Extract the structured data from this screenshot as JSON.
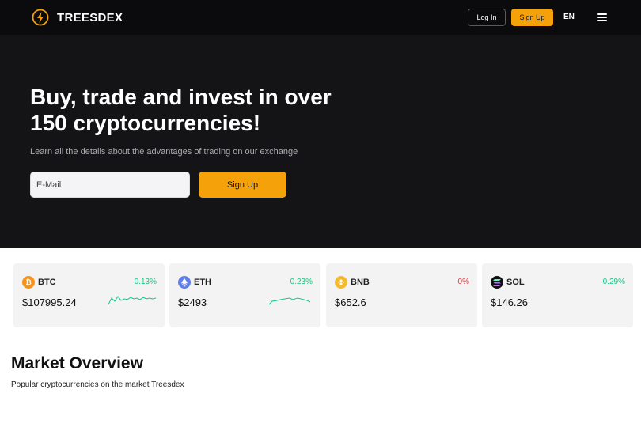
{
  "header": {
    "brand": "TREESDEX",
    "login_label": "Log In",
    "signup_label": "Sign Up",
    "language": "EN",
    "accent": "#f5a10a"
  },
  "hero": {
    "title": "Buy, trade and invest in over 150 cryptocurrencies!",
    "subtitle": "Learn all the details about the advantages of trading on our exchange",
    "email_placeholder": "E-Mail",
    "signup_label": "Sign Up"
  },
  "tickers": [
    {
      "symbol": "BTC",
      "change": "0.13%",
      "price": "$107995.24",
      "icon": "bitcoin-icon",
      "color": "#f7931a",
      "trend": "up"
    },
    {
      "symbol": "ETH",
      "change": "0.23%",
      "price": "$2493",
      "icon": "ethereum-icon",
      "color": "#627eea",
      "trend": "up"
    },
    {
      "symbol": "BNB",
      "change": "0%",
      "price": "$652.6",
      "icon": "bnb-icon",
      "color": "#f3ba2f",
      "trend": "flat"
    },
    {
      "symbol": "SOL",
      "change": "0.29%",
      "price": "$146.26",
      "icon": "solana-icon",
      "color": "#111111",
      "trend": "up"
    }
  ],
  "status_colors": {
    "up": "#16c784",
    "flat": "#ea3943"
  },
  "market": {
    "title": "Market Overview",
    "subtitle": "Popular cryptocurrencies on the market Treesdex"
  }
}
